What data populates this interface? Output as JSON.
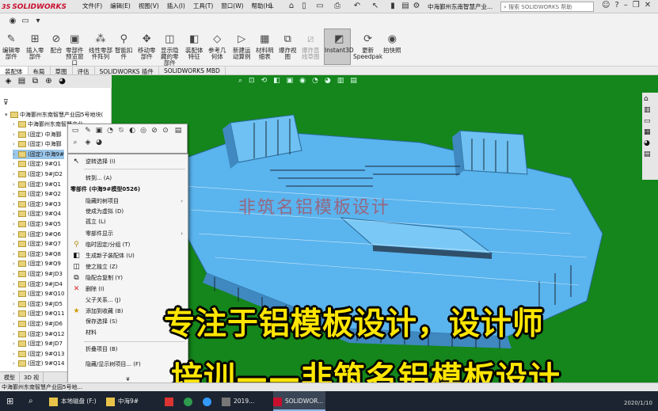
{
  "app": {
    "brand": "SOLIDWORKS",
    "menu": [
      "文件(F)",
      "编辑(E)",
      "视图(V)",
      "插入(I)",
      "工具(T)",
      "窗口(W)",
      "帮助(H)"
    ],
    "doc_title": "中海鄞州东南智慧产业...",
    "search_placeholder": "搜索 SOLIDWORKS 帮助"
  },
  "command_manager": [
    {
      "label": "编辑零\n部件",
      "icon": "edit-component-icon"
    },
    {
      "label": "插入零\n部件",
      "icon": "insert-component-icon"
    },
    {
      "label": "配合",
      "icon": "mate-icon"
    },
    {
      "label": "零部件\n预览窗\n口",
      "icon": "preview-window-icon"
    },
    {
      "label": "线性零部\n件阵列",
      "icon": "linear-pattern-icon"
    },
    {
      "label": "智能扣\n件",
      "icon": "smart-fastener-icon"
    },
    {
      "label": "移动零\n部件",
      "icon": "move-component-icon"
    },
    {
      "label": "显示隐\n藏的零\n部件",
      "icon": "show-hidden-icon"
    },
    {
      "label": "装配体\n特征",
      "icon": "assembly-feature-icon"
    },
    {
      "label": "参考几\n何体",
      "icon": "reference-geometry-icon"
    },
    {
      "label": "新建运\n动算例",
      "icon": "motion-study-icon"
    },
    {
      "label": "材料明\n细表",
      "icon": "bom-icon"
    },
    {
      "label": "爆炸视\n图",
      "icon": "exploded-view-icon"
    },
    {
      "label": "爆炸直\n线草图",
      "icon": "explode-line-icon"
    },
    {
      "label": "Instant3D",
      "icon": "instant3d-icon"
    },
    {
      "label": "更新\nSpeedpak",
      "icon": "speedpak-icon"
    },
    {
      "label": "拍快照",
      "icon": "snapshot-icon"
    }
  ],
  "tabs": [
    "装配体",
    "布局",
    "草图",
    "评估",
    "SOLIDWORKS 插件",
    "SOLIDWORKS MBD"
  ],
  "tree": {
    "root": "中海鄞州东南智慧产业园5号地块(",
    "items": [
      "中海鄞州东南智慧产业",
      "(固定) 中海鄞",
      "(固定) 中海鄞",
      "(固定) 中海9#",
      "(固定) 9#Q1",
      "(固定) 9#JD2",
      "(固定) 9#Q1",
      "(固定) 9#Q2",
      "(固定) 9#Q3",
      "(固定) 9#Q4",
      "(固定) 9#Q5",
      "(固定) 9#Q6",
      "(固定) 9#Q7",
      "(固定) 9#Q8",
      "(固定) 9#Q9",
      "(固定) 9#JD3",
      "(固定) 9#JD4",
      "(固定) 9#Q10",
      "(固定) 9#JD5",
      "(固定) 9#Q11",
      "(固定) 9#JD6",
      "(固定) 9#Q12",
      "(固定) 9#JD7",
      "(固定) 9#Q13",
      "(固定) 9#Q14"
    ],
    "bottom_tabs": [
      "模型",
      "3D 视"
    ]
  },
  "context_menu": {
    "items": [
      {
        "label": "逆转选择 (I)",
        "icon": "select-icon"
      },
      {
        "label": "转到... (A)",
        "icon": ""
      },
      {
        "label": "零部件 (中海9#模型0526)",
        "header": true
      },
      {
        "label": "隐藏的树项目",
        "submenu": true
      },
      {
        "label": "使成为虚拟 (D)"
      },
      {
        "label": "孤立 (L)"
      },
      {
        "label": "零部件显示",
        "submenu": true
      },
      {
        "label": "临时固定/分组 (T)",
        "icon": "fix-icon"
      },
      {
        "label": "生成新子装配体 (U)",
        "icon": "subassembly-icon"
      },
      {
        "label": "使之独立 (Z)",
        "icon": "independent-icon"
      },
      {
        "label": "隐配合复制 (Y)",
        "icon": "copy-mates-icon"
      },
      {
        "label": "删除 (I)",
        "icon": "delete-icon"
      },
      {
        "label": "父子关系... (J)"
      },
      {
        "label": "添加到收藏 (B)",
        "icon": "favorite-icon"
      },
      {
        "label": "保存选择 (S)"
      },
      {
        "label": "材料"
      },
      {
        "label": "折叠项目 (B)"
      },
      {
        "label": "隐藏/显示树项目... (F)"
      }
    ],
    "more": "¥"
  },
  "overlay": {
    "watermark": "非筑名铝模板设计",
    "line1": "专注于铝模板设计，设计师",
    "line2": "培训——非筑名铝模板设计"
  },
  "status_bar": "中海鄞州东南智慧产业园5号地...",
  "taskbar": [
    {
      "label": "本地磁盘 (F:)"
    },
    {
      "label": "中海9#"
    },
    {
      "label": "2019..."
    },
    {
      "label": "SOLIDWOR...",
      "active": true
    }
  ],
  "clock": "2020/1/10",
  "colors": {
    "viewport": "#14861b",
    "model": "#5ab4ee",
    "accent": "#ffe600",
    "watermark": "#c82828"
  }
}
